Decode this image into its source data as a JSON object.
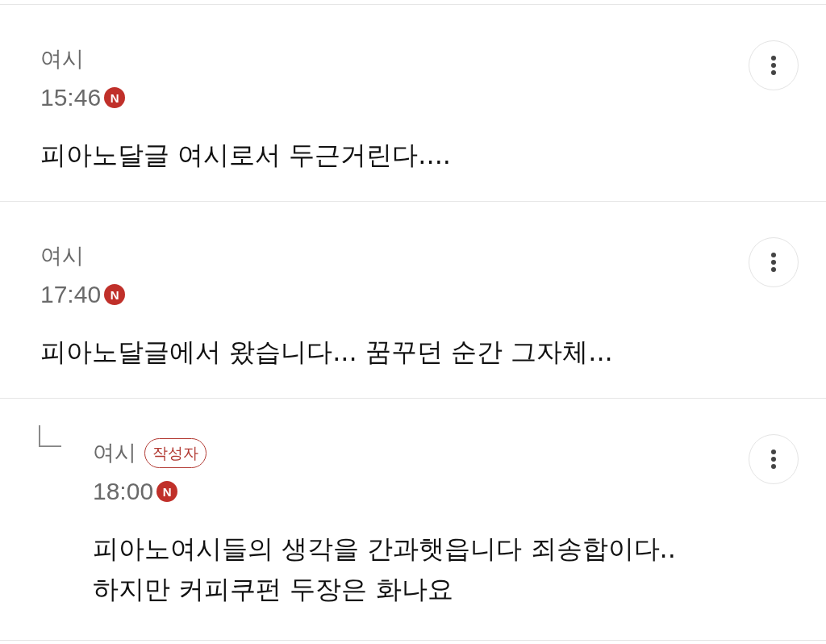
{
  "comments": [
    {
      "kind": "comment",
      "author": "여시",
      "time": "15:46",
      "new_mark": "N",
      "text": "피아노달글 여시로서 두근거린다...."
    },
    {
      "kind": "comment",
      "author": "여시",
      "time": "17:40",
      "new_mark": "N",
      "text": "피아노달글에서 왔습니다... 꿈꾸던 순간 그자체..."
    },
    {
      "kind": "reply",
      "author": "여시",
      "author_badge": "작성자",
      "time": "18:00",
      "new_mark": "N",
      "text": "피아노여시들의 생각을 간과햇읍니다 죄송합이다..\n하지만 커피쿠펀 두장은 화나요"
    }
  ]
}
